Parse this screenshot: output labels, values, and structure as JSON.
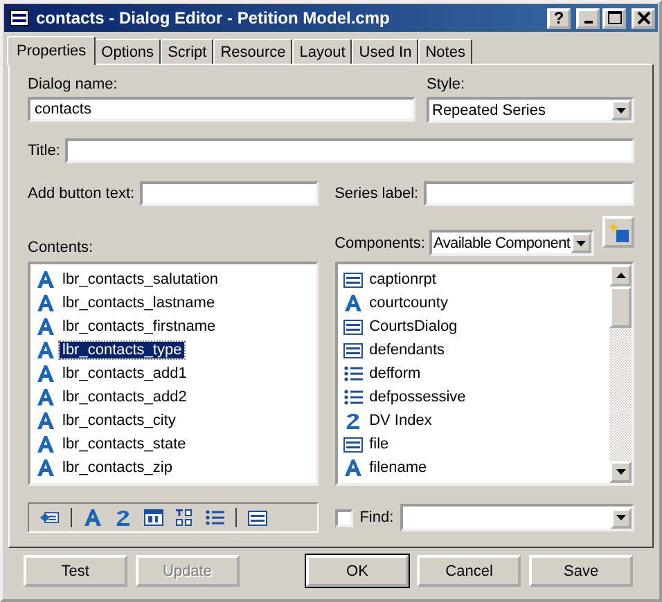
{
  "window": {
    "title": "contacts - Dialog Editor - Petition Model.cmp",
    "controls": [
      "?"
    ]
  },
  "tabs": [
    {
      "label": "Properties",
      "selected": true
    },
    {
      "label": "Options",
      "selected": false
    },
    {
      "label": "Script",
      "selected": false
    },
    {
      "label": "Resource",
      "selected": false
    },
    {
      "label": "Layout",
      "selected": false
    },
    {
      "label": "Used In",
      "selected": false
    },
    {
      "label": "Notes",
      "selected": false
    }
  ],
  "dialog_name": {
    "label": "Dialog name:",
    "value": "contacts"
  },
  "style": {
    "label": "Style:",
    "value": "Repeated Series"
  },
  "title_field": {
    "label": "Title:"
  },
  "add_button_text": {
    "label": "Add button text:"
  },
  "series_label": {
    "label": "Series label:"
  },
  "contents": {
    "label": "Contents:",
    "items": [
      {
        "name": "lbr_contacts_salutation",
        "kind": "text",
        "selected": false
      },
      {
        "name": "lbr_contacts_lastname",
        "kind": "text",
        "selected": false
      },
      {
        "name": "lbr_contacts_firstname",
        "kind": "text",
        "selected": false
      },
      {
        "name": "lbr_contacts_type",
        "kind": "text",
        "selected": true
      },
      {
        "name": "lbr_contacts_add1",
        "kind": "text",
        "selected": false
      },
      {
        "name": "lbr_contacts_add2",
        "kind": "text",
        "selected": false
      },
      {
        "name": "lbr_contacts_city",
        "kind": "text",
        "selected": false
      },
      {
        "name": "lbr_contacts_state",
        "kind": "text",
        "selected": false
      },
      {
        "name": "lbr_contacts_zip",
        "kind": "text",
        "selected": false
      }
    ]
  },
  "components": {
    "label": "Components:",
    "filter": "Available Component",
    "items": [
      {
        "name": "captionrpt",
        "kind": "group"
      },
      {
        "name": "courtcounty",
        "kind": "text"
      },
      {
        "name": "CourtsDialog",
        "kind": "group"
      },
      {
        "name": "defendants",
        "kind": "group"
      },
      {
        "name": "defform",
        "kind": "multi"
      },
      {
        "name": "defpossessive",
        "kind": "multi"
      },
      {
        "name": "DV Index",
        "kind": "number"
      },
      {
        "name": "file",
        "kind": "group"
      },
      {
        "name": "filename",
        "kind": "text"
      }
    ]
  },
  "find": {
    "label": "Find:",
    "checked": false
  },
  "buttons": [
    {
      "label": "Test",
      "disabled": false,
      "default": false
    },
    {
      "label": "Update",
      "disabled": true,
      "default": false
    },
    {
      "label": "OK",
      "disabled": false,
      "default": true
    },
    {
      "label": "Cancel",
      "disabled": false,
      "default": false
    },
    {
      "label": "Save",
      "disabled": false,
      "default": false
    }
  ]
}
